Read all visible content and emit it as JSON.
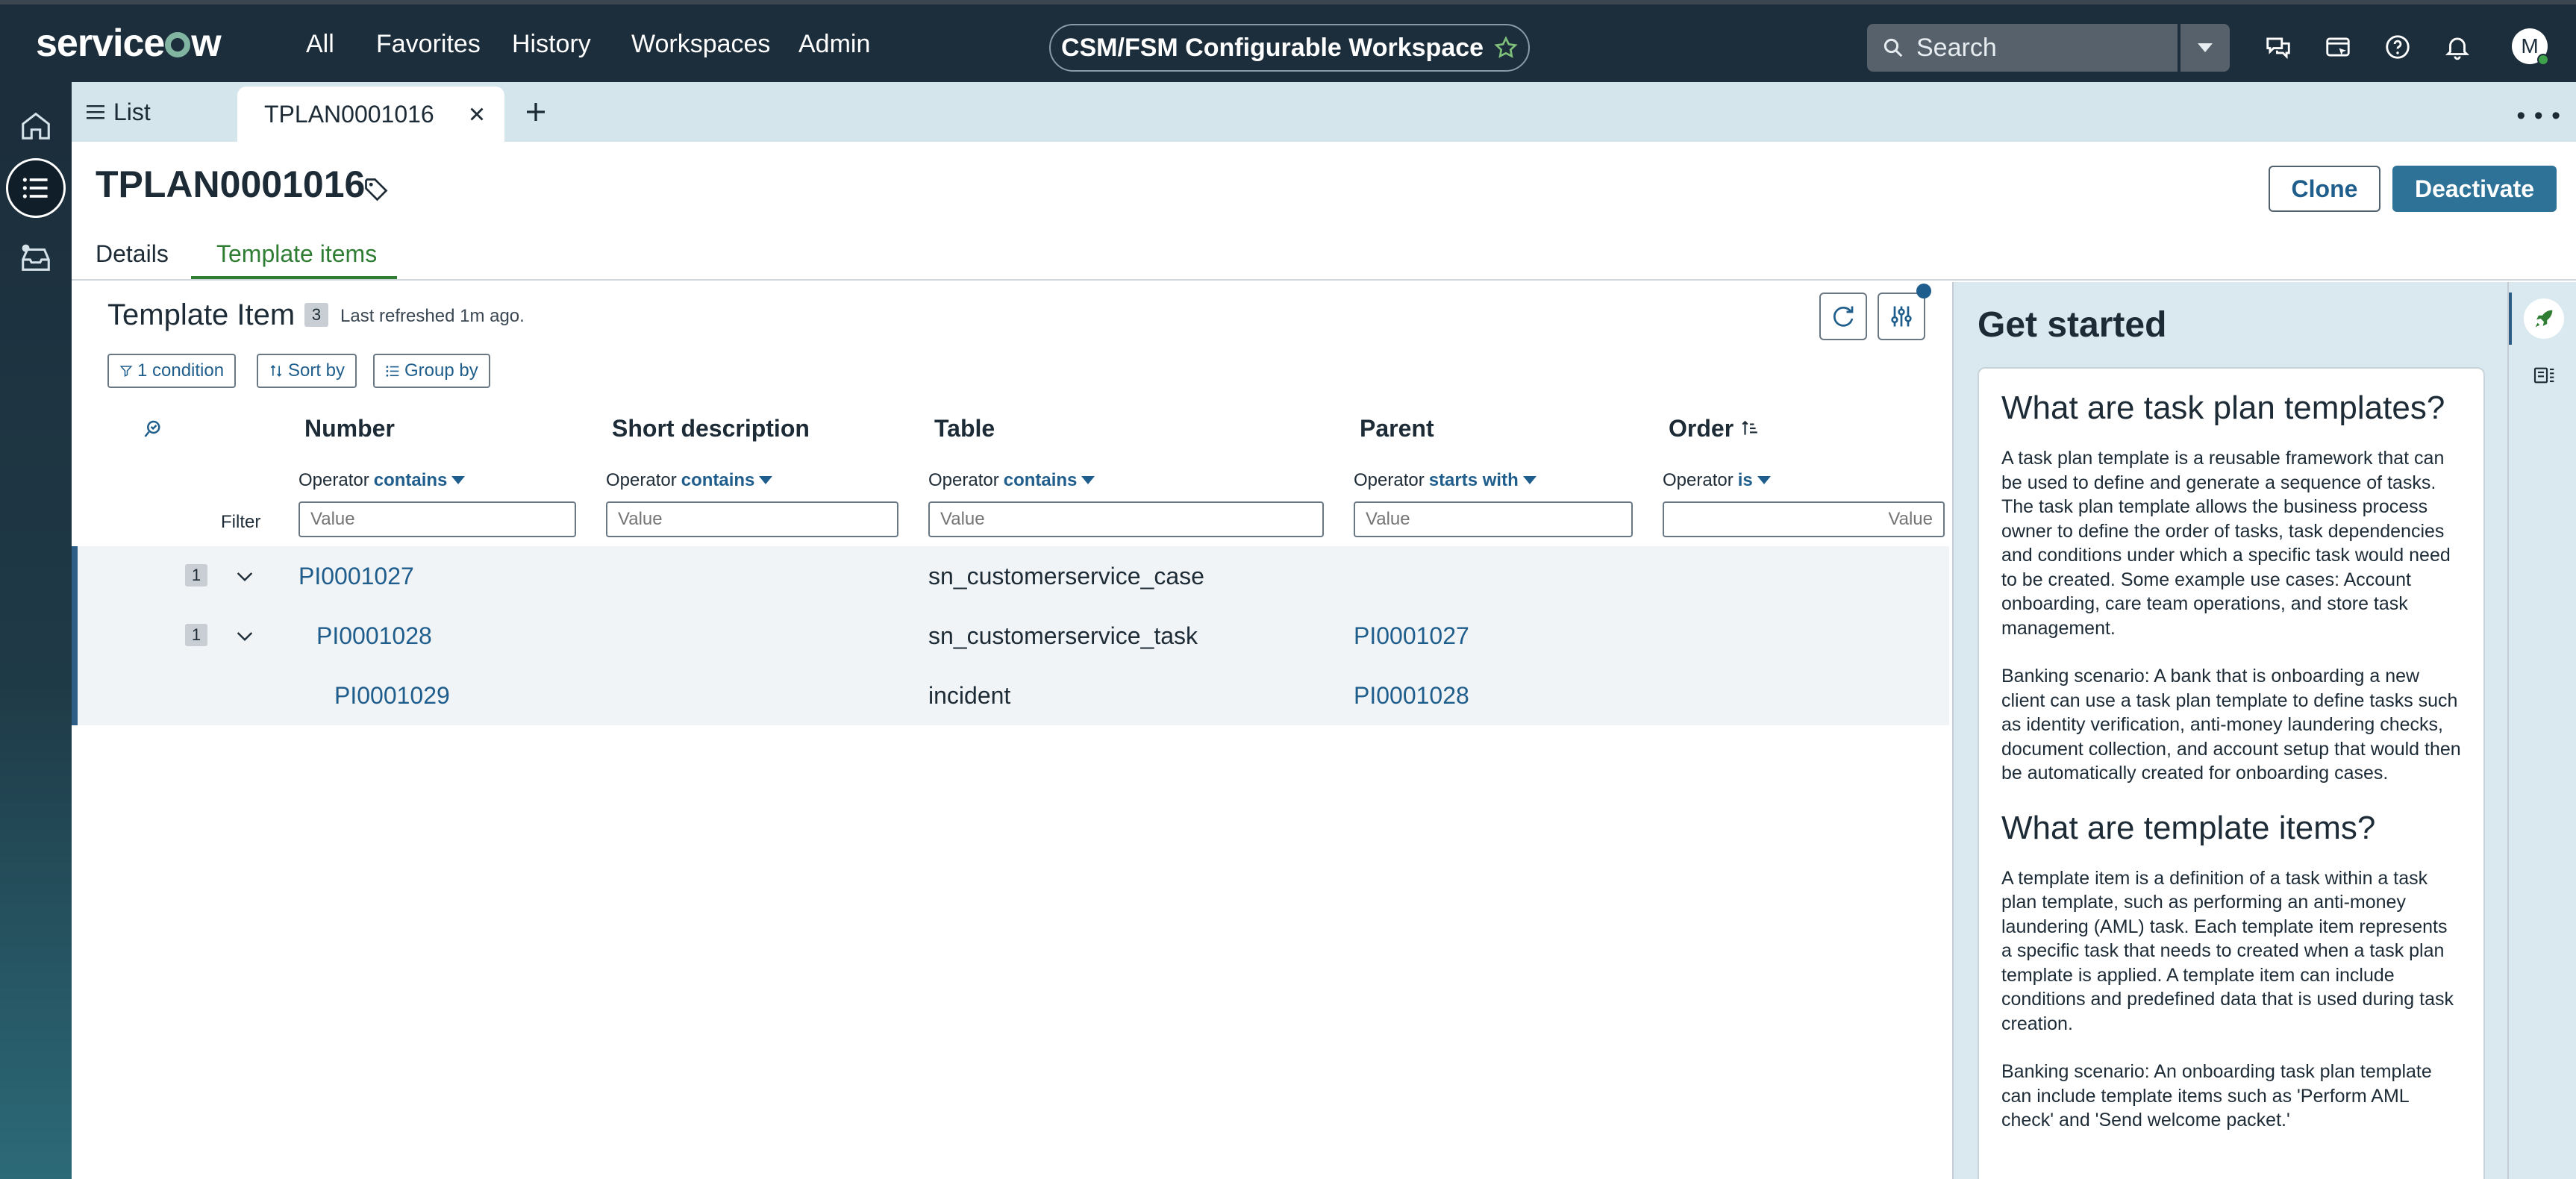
{
  "topnav": {
    "logo": "servicenow",
    "links": [
      "All",
      "Favorites",
      "History",
      "Workspaces",
      "Admin"
    ],
    "workspace_name": "CSM/FSM Configurable Workspace",
    "search_placeholder": "Search",
    "avatar_initial": "M",
    "icons": [
      "chat-icon",
      "contextual-app-icon",
      "help-icon",
      "bell-icon"
    ]
  },
  "rail": {
    "items": [
      "home-icon",
      "list-icon",
      "inbox-icon"
    ]
  },
  "tabs": {
    "list_label": "List",
    "record_label": "TPLAN0001016"
  },
  "record": {
    "title": "TPLAN0001016",
    "clone_label": "Clone",
    "deactivate_label": "Deactivate",
    "tabs": [
      "Details",
      "Template items"
    ],
    "active_tab": "Template items"
  },
  "list": {
    "title": "Template Item",
    "count": "3",
    "refreshed": "Last refreshed 1m ago.",
    "chips": [
      "1 condition",
      "Sort by",
      "Group by"
    ],
    "filter_label": "Filter",
    "columns": [
      {
        "header": "Number",
        "operator_label": "Operator",
        "operator": "contains",
        "placeholder": "Value"
      },
      {
        "header": "Short description",
        "operator_label": "Operator",
        "operator": "contains",
        "placeholder": "Value"
      },
      {
        "header": "Table",
        "operator_label": "Operator",
        "operator": "contains",
        "placeholder": "Value"
      },
      {
        "header": "Parent",
        "operator_label": "Operator",
        "operator": "starts with",
        "placeholder": "Value"
      },
      {
        "header": "Order",
        "operator_label": "Operator",
        "operator": "is",
        "placeholder": "Value"
      }
    ],
    "rows": [
      {
        "badge": "1",
        "number": "PI0001027",
        "short_description": "",
        "table": "sn_customerservice_case",
        "parent": "",
        "order": ""
      },
      {
        "badge": "1",
        "number": "PI0001028",
        "short_description": "",
        "table": "sn_customerservice_task",
        "parent": "PI0001027",
        "order": ""
      },
      {
        "badge": "",
        "number": "PI0001029",
        "short_description": "",
        "table": "incident",
        "parent": "PI0001028",
        "order": ""
      }
    ]
  },
  "get_started": {
    "title": "Get started",
    "h1": "What are task plan templates?",
    "p1": "A task plan template is a reusable framework that can be used to define and generate a sequence of tasks. The task plan template allows the business process owner to define the order of tasks, task dependencies and conditions under which a specific task would need to be created. Some example use cases: Account onboarding, care team operations, and store task management.",
    "p2": "Banking scenario: A bank that is onboarding a new client can use a task plan template to define tasks such as identity verification, anti-money laundering checks, document collection, and account setup that would then be automatically created for onboarding cases.",
    "h2": "What are template items?",
    "p3": "A template item is a definition of a task within a task plan template, such as performing an anti-money laundering (AML) task. Each template item represents a specific task that needs to created when a task plan template is applied. A template item can include conditions and predefined data that is used during task creation.",
    "p4": "Banking scenario: An onboarding task plan template can include template items such as 'Perform AML check' and 'Send welcome packet.'"
  },
  "colors": {
    "nav_bg": "#1c2d3b",
    "accent_blue": "#1f5e8c",
    "deactivate_bg": "#2e7397",
    "tab_active_green": "#2e7d32",
    "panel_bg": "#d9e9ef"
  }
}
